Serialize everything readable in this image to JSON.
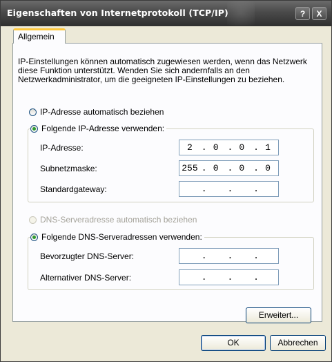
{
  "window": {
    "title": "Eigenschaften von Internetprotokoll (TCP/IP)",
    "help_button": "?",
    "close_button": "X"
  },
  "tabs": [
    {
      "label": "Allgemein",
      "active": true
    }
  ],
  "description": "IP-Einstellungen können automatisch zugewiesen werden, wenn das Netzwerk diese Funktion unterstützt. Wenden Sie sich andernfalls an den Netzwerkadministrator, um die geeigneten IP-Einstellungen zu beziehen.",
  "ip_section": {
    "auto_option": {
      "label": "IP-Adresse automatisch beziehen",
      "checked": false
    },
    "manual_option": {
      "label": "Folgende IP-Adresse verwenden:",
      "checked": true
    },
    "fields": [
      {
        "label": "IP-Adresse:",
        "octets": [
          "2",
          "0",
          "0",
          "1"
        ]
      },
      {
        "label": "Subnetzmaske:",
        "octets": [
          "255",
          "0",
          "0",
          "0"
        ]
      },
      {
        "label": "Standardgateway:",
        "octets": [
          "",
          "",
          "",
          ""
        ]
      }
    ]
  },
  "dns_section": {
    "auto_option": {
      "label": "DNS-Serveradresse automatisch beziehen",
      "checked": false,
      "disabled": true
    },
    "manual_option": {
      "label": "Folgende DNS-Serveradressen verwenden:",
      "checked": true
    },
    "fields": [
      {
        "label": "Bevorzugter DNS-Server:",
        "octets": [
          "",
          "",
          "",
          ""
        ]
      },
      {
        "label": "Alternativer DNS-Server:",
        "octets": [
          "",
          "",
          "",
          ""
        ]
      }
    ]
  },
  "buttons": {
    "advanced": "Erweitert...",
    "ok": "OK",
    "cancel": "Abbrechen"
  },
  "colors": {
    "titlebar": "#4a4a4a",
    "face": "#ece9d8",
    "tab_highlight": "#ffc83c",
    "radio_check": "#2f9a2f"
  }
}
